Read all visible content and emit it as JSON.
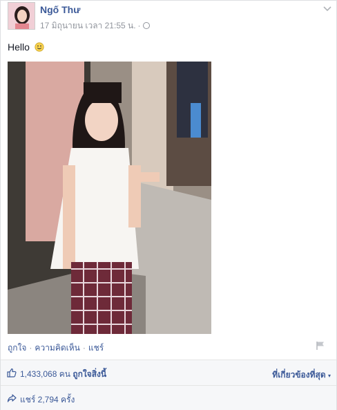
{
  "post": {
    "author": "Ngố Thư",
    "timestamp": "17 มิถุนายน เวลา 21:55 น.",
    "separator": "·",
    "privacy_icon": "globe-icon",
    "status_text": "Hello",
    "status_emoji": "smiley-icon"
  },
  "actions": {
    "like": "ถูกใจ",
    "comment": "ความคิดเห็น",
    "share": "แชร์",
    "dot": "·"
  },
  "likes": {
    "count": "1,433,068",
    "unit": "คน",
    "label": "ถูกใจสิ่งนี้",
    "sort_label": "ที่เกี่ยวข้องที่สุด"
  },
  "shares": {
    "text": "แชร์ 2,794 ครั้ง"
  },
  "colors": {
    "link": "#3b5998",
    "meta": "#90949c",
    "bar_bg": "#f6f7f9"
  }
}
